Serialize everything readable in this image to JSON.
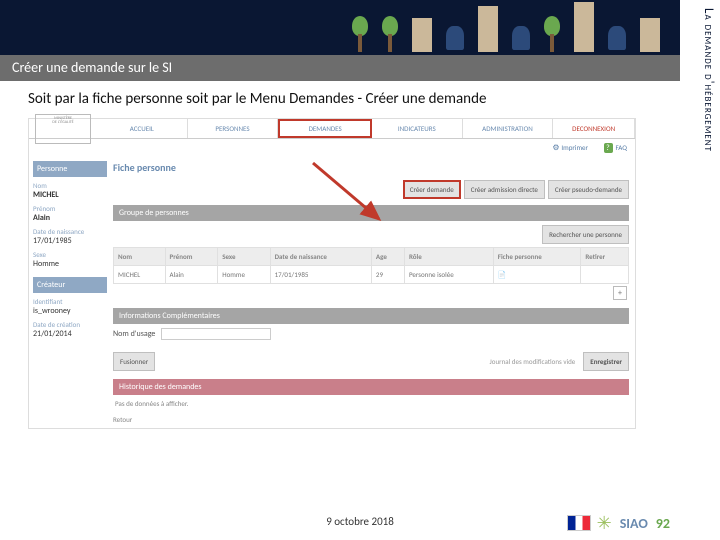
{
  "sidebar_title_vertical": "La demande d'hébergement",
  "title_bar": "Créer une demande sur le SI",
  "intro": "Soit par la fiche personne soit par le Menu Demandes - Créer une demande",
  "nav": {
    "accueil": "ACCUEIL",
    "personnes": "PERSONNES",
    "demandes": "DEMANDES",
    "indicateurs": "INDICATEURS",
    "administration": "ADMINISTRATION",
    "deconnexion": "DECONNEXION"
  },
  "toolbar": {
    "imprimer": "Imprimer",
    "faq": "FAQ"
  },
  "fiche_title": "Fiche personne",
  "buttons": {
    "creer_demande": "Créer demande",
    "creer_admission": "Créer admission directe",
    "creer_pseudo": "Créer pseudo-demande",
    "rechercher": "Rechercher une personne",
    "fusionner": "Fusionner",
    "enregistrer": "Enregistrer",
    "retour": "Retour"
  },
  "side": {
    "personne_head": "Personne",
    "nom_lbl": "Nom",
    "nom_val": "MICHEL",
    "prenom_lbl": "Prénom",
    "prenom_val": "Alain",
    "dob_lbl": "Date de naissance",
    "dob_val": "17/01/1985",
    "sexe_lbl": "Sexe",
    "sexe_val": "Homme",
    "createur_head": "Créateur",
    "ident_lbl": "Identifiant",
    "ident_val": "is_wrooney",
    "crea_lbl": "Date de création",
    "crea_val": "21/01/2014"
  },
  "sections": {
    "groupe": "Groupe de personnes",
    "info_comp": "Informations Complémentaires",
    "hist": "Historique des demandes"
  },
  "table": {
    "headers": {
      "nom": "Nom",
      "prenom": "Prénom",
      "sexe": "Sexe",
      "dob": "Date de naissance",
      "age": "Age",
      "role": "Rôle",
      "fiche": "Fiche personne",
      "retirer": "Retirer"
    },
    "row": {
      "nom": "MICHEL",
      "prenom": "Alain",
      "sexe": "Homme",
      "dob": "17/01/1985",
      "age": "29",
      "role": "Personne isolée"
    }
  },
  "nom_usage_lbl": "Nom d'usage",
  "journal": "Journal des modifications vide",
  "no_data": "Pas de données à afficher.",
  "footer_date": "9 octobre 2018",
  "logo": {
    "siao": "SIAO",
    "dept": "92"
  }
}
